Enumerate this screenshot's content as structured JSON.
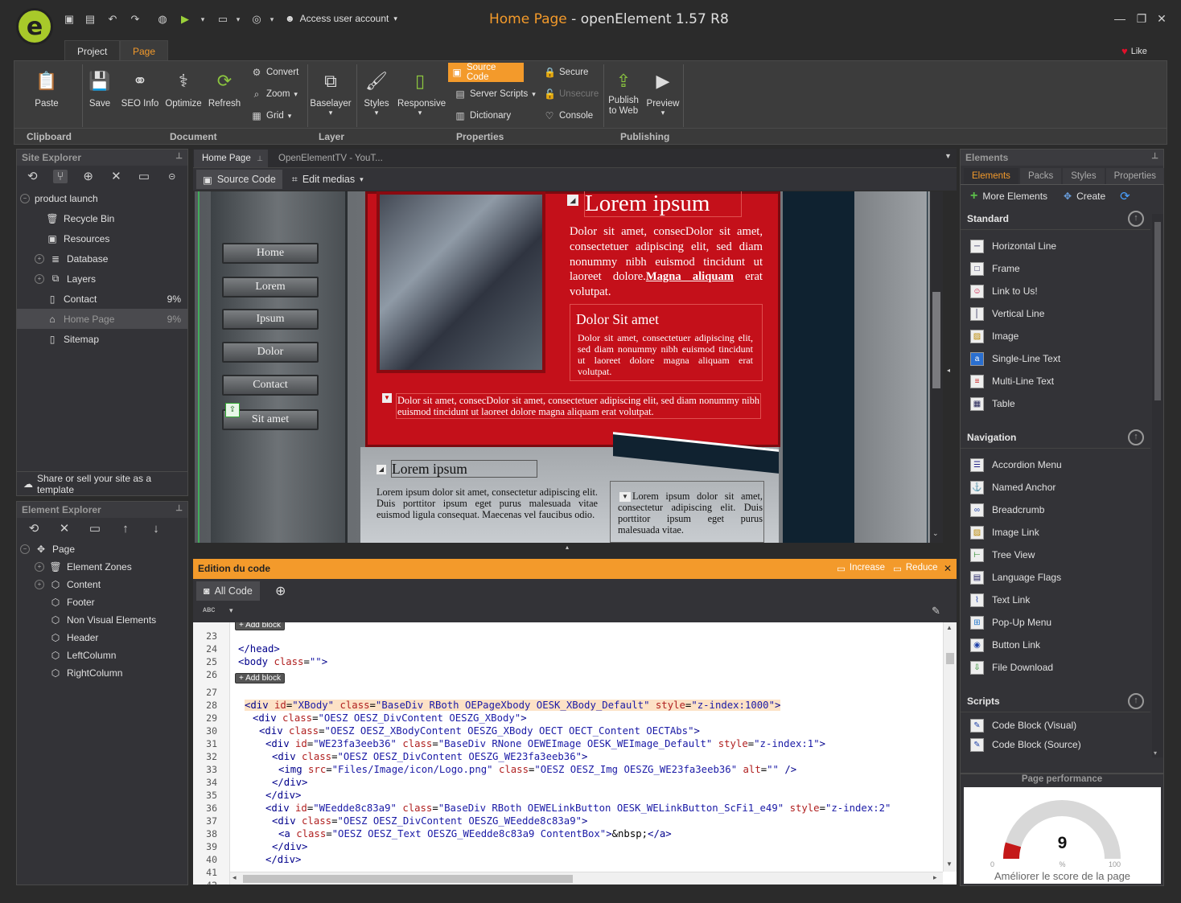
{
  "app": {
    "title_page": "Home Page",
    "title_app": " - openElement 1.57 R8",
    "logo_letter": "e",
    "account_label": "Access user account",
    "like_label": "Like"
  },
  "ribbon_tabs": [
    "Project",
    "Page"
  ],
  "ribbon": {
    "paste": "Paste",
    "save": "Save",
    "seo": "SEO Info",
    "optimize": "Optimize",
    "refresh": "Refresh",
    "convert": "Convert",
    "zoom": "Zoom",
    "grid": "Grid",
    "baselayer": "Baselayer",
    "styles": "Styles",
    "responsive": "Responsive",
    "source_code": "Source Code",
    "server_scripts": "Server Scripts",
    "dictionary": "Dictionary",
    "secure": "Secure",
    "unsecure": "Unsecure",
    "console": "Console",
    "publish_1": "Publish",
    "publish_2": "to Web",
    "preview": "Preview",
    "groups": [
      "Clipboard",
      "Document",
      "Layer",
      "Properties",
      "Publishing"
    ]
  },
  "site_explorer": {
    "title": "Site Explorer",
    "items": [
      {
        "label": "product launch",
        "pct": ""
      },
      {
        "label": "Recycle Bin",
        "pct": ""
      },
      {
        "label": "Resources",
        "pct": ""
      },
      {
        "label": "Database",
        "pct": ""
      },
      {
        "label": "Layers",
        "pct": ""
      },
      {
        "label": "Contact",
        "pct": "9%"
      },
      {
        "label": "Home Page",
        "pct": "9%"
      },
      {
        "label": "Sitemap",
        "pct": ""
      }
    ],
    "share_label": "Share or sell your site as a template"
  },
  "element_explorer": {
    "title": "Element Explorer",
    "items": [
      "Page",
      "Element Zones",
      "Content",
      "Footer",
      "Non Visual Elements",
      "Header",
      "LeftColumn",
      "RightColumn"
    ]
  },
  "doc_tabs": [
    "Home Page",
    "OpenElementTV - YouT..."
  ],
  "doc_toolbar": {
    "source_code": "Source Code",
    "edit_medias": "Edit medias"
  },
  "canvas": {
    "menu": [
      "Home",
      "Lorem",
      "Ipsum",
      "Dolor",
      "Contact",
      "Sit amet"
    ],
    "heading": "Lorem ipsum",
    "para1_text": "Dolor sit amet, consecDolor sit amet, consectetuer adipiscing elit, sed diam nonummy nibh euismod tincidunt ut laoreet dolore.",
    "para1_link": "Magna aliquam",
    "para1_end": " erat volutpat.",
    "subheading": "Dolor Sit amet",
    "para2": "Dolor sit amet, consectetuer adipiscing elit, sed diam nonummy nibh euismod tincidunt ut laoreet dolore magna aliquam erat volutpat.",
    "para3": "Dolor sit amet, consecDolor sit amet, consectetuer adipiscing elit, sed diam nonummy nibh euismod tincidunt ut laoreet dolore magna aliquam erat volutpat.",
    "bottom_heading": "Lorem ipsum",
    "bottom_para": "Lorem ipsum dolor sit amet, consectetur adipiscing elit. Duis porttitor ipsum eget purus malesuada vitae euismod ligula consequat. Maecenas vel faucibus odio.",
    "bottom_right": "Lorem ipsum dolor sit amet, consectetur adipiscing elit. Duis porttitor ipsum eget purus malesuada vitae."
  },
  "code_panel": {
    "title": "Edition du code",
    "increase": "Increase",
    "reduce": "Reduce",
    "all_code": "All Code",
    "add_block": "+ Add block",
    "line_numbers": [
      "23",
      "24",
      "25",
      "26",
      "27",
      "28",
      "29",
      "30",
      "31",
      "32",
      "33",
      "34",
      "35",
      "36",
      "37",
      "38",
      "39",
      "40",
      "41",
      "42"
    ]
  },
  "elements_panel": {
    "title": "Elements",
    "tabs": [
      "Elements",
      "Packs",
      "Styles",
      "Properties"
    ],
    "more_elements": "More Elements",
    "create": "Create",
    "categories": {
      "standard": "Standard",
      "navigation": "Navigation",
      "scripts": "Scripts"
    },
    "standard": [
      "Horizontal Line",
      "Frame",
      "Link to Us!",
      "Vertical Line",
      "Image",
      "Single-Line Text",
      "Multi-Line Text",
      "Table"
    ],
    "navigation": [
      "Accordion Menu",
      "Named Anchor",
      "Breadcrumb",
      "Image Link",
      "Tree View",
      "Language Flags",
      "Text Link",
      "Pop-Up Menu",
      "Button Link",
      "File Download"
    ],
    "scripts": [
      "Code Block (Visual)",
      "Code Block (Source)"
    ]
  },
  "performance": {
    "title": "Page performance",
    "score": "9",
    "min": "0",
    "pct": "%",
    "max": "100",
    "caption": "Améliorer le score de la page",
    "score_value": 9
  },
  "colors": {
    "accent": "#f39a2b",
    "bg": "#2b2b2b",
    "red": "#c0101a"
  }
}
